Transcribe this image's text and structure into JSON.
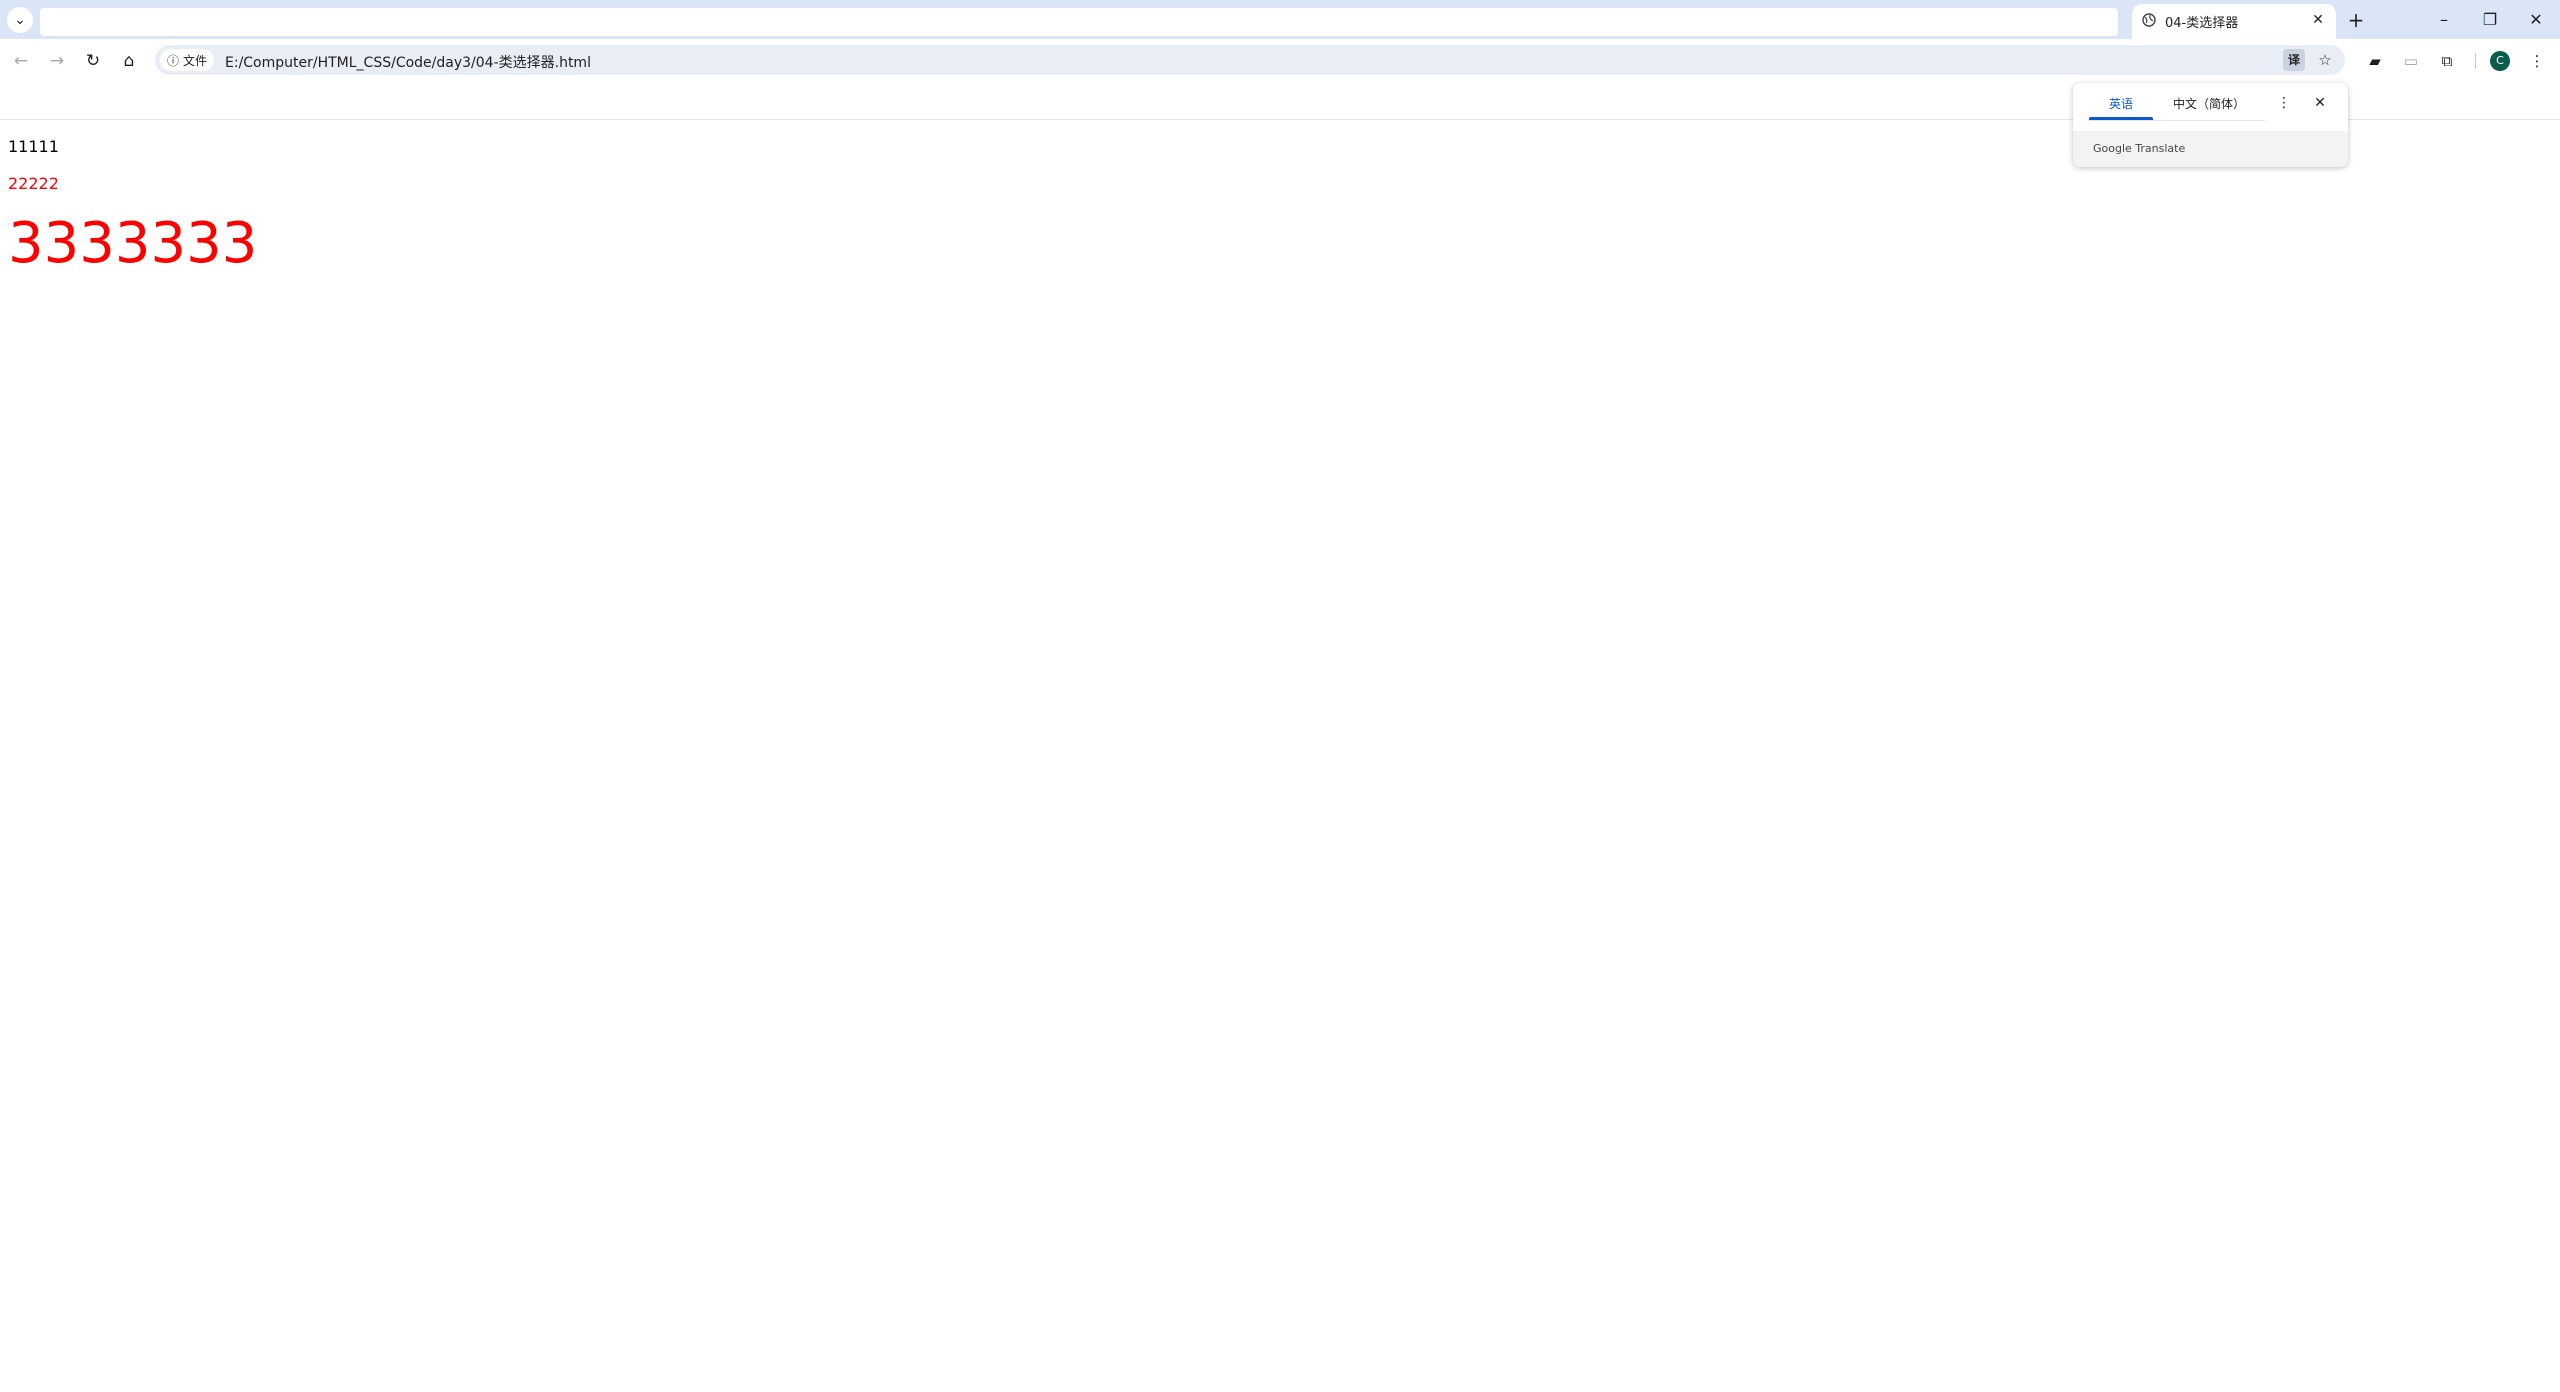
{
  "browser": {
    "tab": {
      "title": "04-类选择器",
      "favicon": "globe-icon",
      "close_glyph": "✕"
    },
    "tab_search_glyph": "⌄",
    "new_tab_glyph": "+",
    "window_controls": {
      "minimize": "–",
      "restore": "❐",
      "close": "✕"
    },
    "toolbar": {
      "back_glyph": "←",
      "forward_glyph": "→",
      "reload_glyph": "↻",
      "home_glyph": "⌂",
      "site_info_glyph": "ⓘ",
      "site_info_label": "文件",
      "url": "E:/Computer/HTML_CSS/Code/day3/04-类选择器.html",
      "translate_glyph": "译",
      "bookmark_glyph": "☆",
      "extension_a_glyph": "▰",
      "extension_b_glyph": "▭",
      "extensions_glyph": "⧉",
      "avatar_letter": "C",
      "menu_glyph": "⋮"
    }
  },
  "translate_popup": {
    "tabs": [
      "英语",
      "中文（简体）"
    ],
    "active_tab": 0,
    "more_glyph": "⋮",
    "close_glyph": "✕",
    "brand": "Google Translate"
  },
  "page": {
    "lines": [
      "11111",
      "22222",
      "3333333"
    ],
    "colors": {
      "default": "#000000",
      "red": "#ff0000"
    }
  }
}
